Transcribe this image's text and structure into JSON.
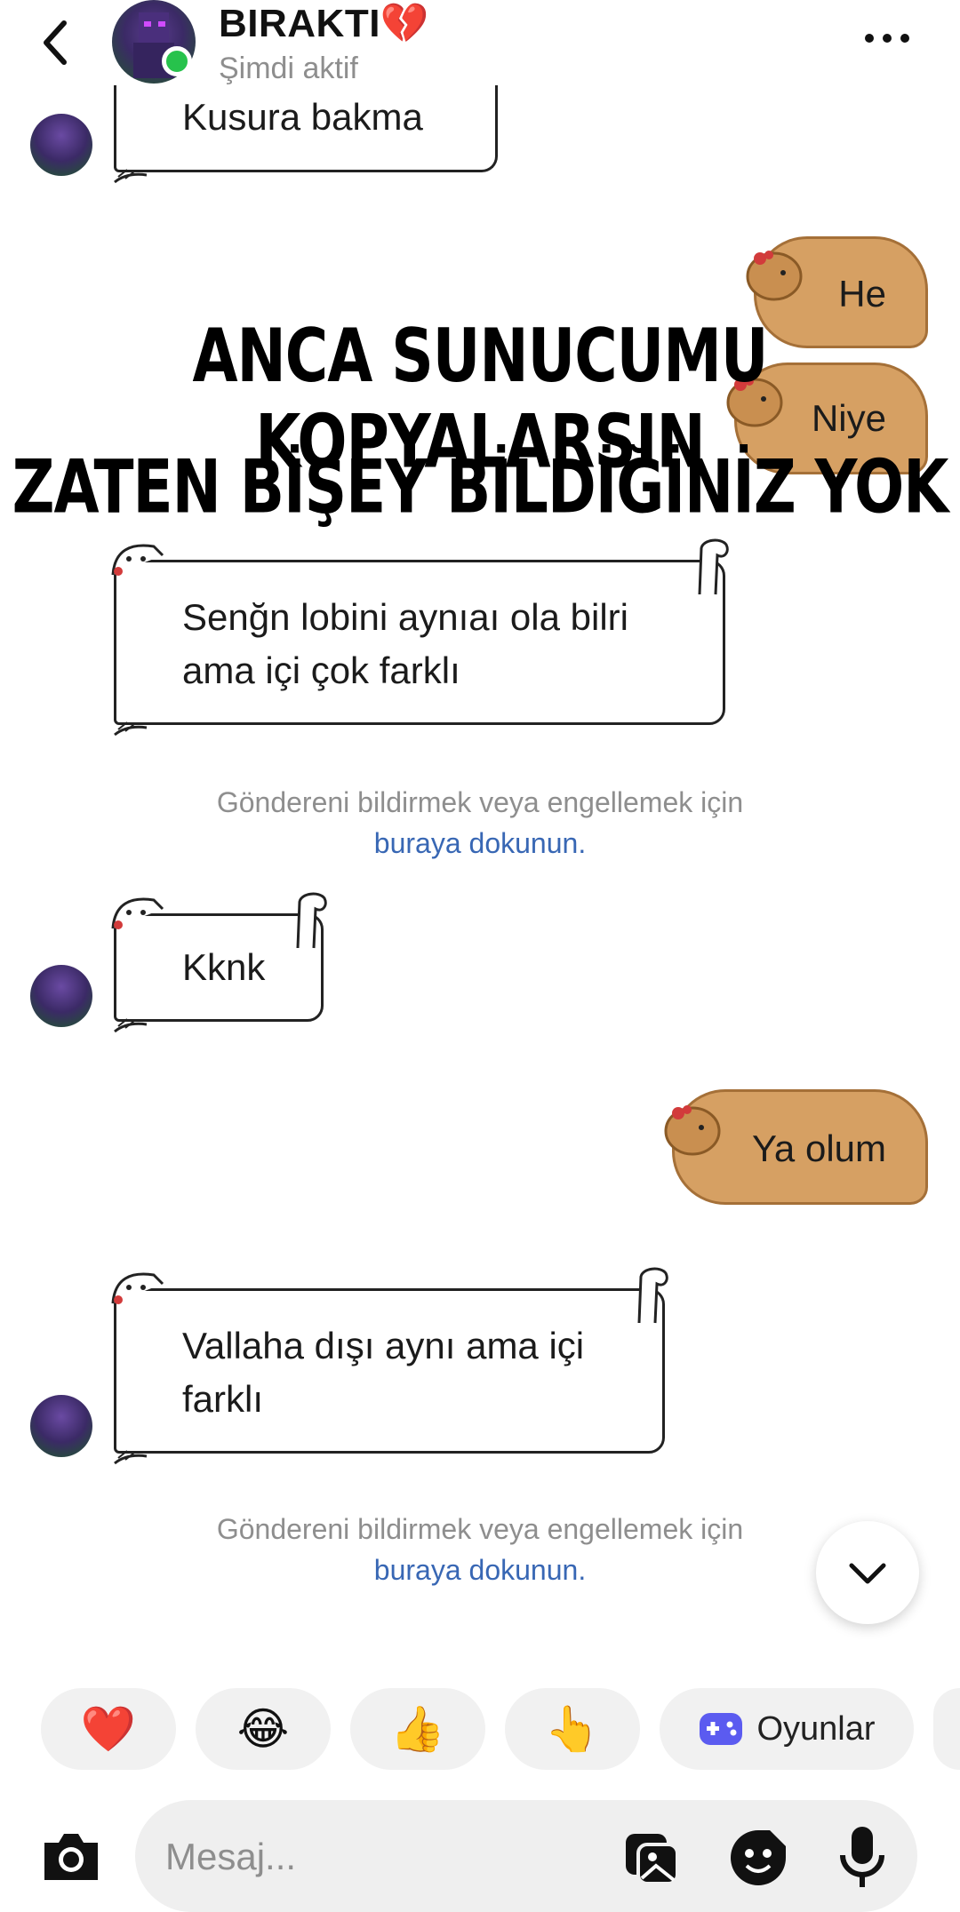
{
  "header": {
    "name": "BIRAKTI💔",
    "status": "Şimdi aktif"
  },
  "meme": {
    "line1": "ANCA SUNUCUMU KOPYALARSIN",
    "line2": "ZATEN BİŞEY BİLDİĞİNİZ YOK"
  },
  "messages": {
    "m1": "Kusura bakma",
    "m2": "He",
    "m3": "Niye",
    "m4_line1": "Senğn lobini aynıaı ola bilri",
    "m4_line2": "ama içi çok farklı",
    "m5": "Kknk",
    "m6": "Ya olum",
    "m7_line1": "Vallaha dışı aynı ama içi",
    "m7_line2": "farklı"
  },
  "notice": {
    "text": "Göndereni bildirmek veya engellemek için",
    "link": "buraya dokunun."
  },
  "quick_reactions": {
    "heart": "❤️",
    "laugh": "😂",
    "thumbs": "👍",
    "point": "👆",
    "games_label": "Oyunlar"
  },
  "composer": {
    "placeholder": "Mesaj..."
  },
  "colors": {
    "link": "#3867b4",
    "online": "#27c24c",
    "capybara": "#d6a063",
    "games_icon": "#5b5bf0"
  }
}
